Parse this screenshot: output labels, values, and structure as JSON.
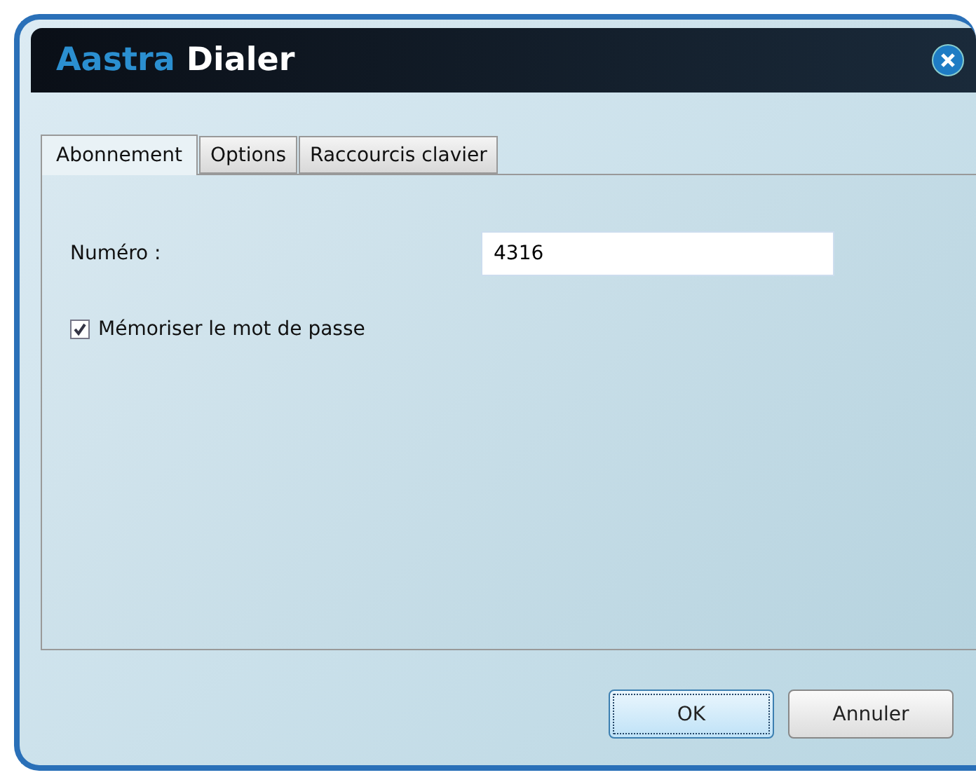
{
  "window": {
    "title_brand": "Aastra",
    "title_name": "Dialer"
  },
  "tabs": [
    {
      "label": "Abonnement",
      "selected": true
    },
    {
      "label": "Options",
      "selected": false
    },
    {
      "label": "Raccourcis clavier",
      "selected": false
    }
  ],
  "form": {
    "number_label": "Numéro :",
    "number_value": "4316",
    "remember_label": "Mémoriser le mot de passe",
    "remember_checked": true
  },
  "buttons": [
    {
      "label": "OK",
      "default": true
    },
    {
      "label": "Annuler",
      "default": false
    }
  ]
}
